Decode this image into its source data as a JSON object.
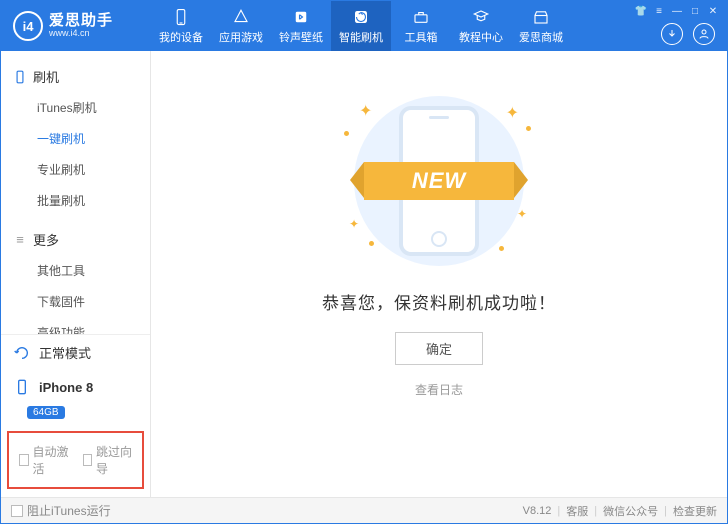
{
  "brand": {
    "name": "爱思助手",
    "logo_glyph": "i4",
    "url": "www.i4.cn"
  },
  "nav": {
    "items": [
      {
        "key": "device",
        "label": "我的设备"
      },
      {
        "key": "apps",
        "label": "应用游戏"
      },
      {
        "key": "ring",
        "label": "铃声壁纸"
      },
      {
        "key": "flash",
        "label": "智能刷机",
        "active": true
      },
      {
        "key": "toolbox",
        "label": "工具箱"
      },
      {
        "key": "tutorial",
        "label": "教程中心"
      },
      {
        "key": "store",
        "label": "爱思商城"
      }
    ]
  },
  "sidebar": {
    "groups": [
      {
        "key": "flash",
        "title": "刷机",
        "items": [
          {
            "key": "itunes-flash",
            "label": "iTunes刷机"
          },
          {
            "key": "onekey-flash",
            "label": "一键刷机",
            "active": true
          },
          {
            "key": "pro-flash",
            "label": "专业刷机"
          },
          {
            "key": "batch-flash",
            "label": "批量刷机"
          }
        ]
      },
      {
        "key": "more",
        "title": "更多",
        "items": [
          {
            "key": "other-tools",
            "label": "其他工具"
          },
          {
            "key": "download-fw",
            "label": "下载固件"
          },
          {
            "key": "advanced",
            "label": "高级功能"
          }
        ]
      }
    ],
    "mode": {
      "label": "正常模式"
    },
    "device": {
      "name": "iPhone 8",
      "storage": "64GB"
    },
    "options": {
      "auto_activate": "自动激活",
      "skip_guide": "跳过向导"
    }
  },
  "main": {
    "ribbon_text": "NEW",
    "success_text": "恭喜您，保资料刷机成功啦！",
    "ok_label": "确定",
    "log_link": "查看日志"
  },
  "footer": {
    "block_itunes": "阻止iTunes运行",
    "version": "V8.12",
    "support": "客服",
    "wechat": "微信公众号",
    "update": "检查更新"
  }
}
